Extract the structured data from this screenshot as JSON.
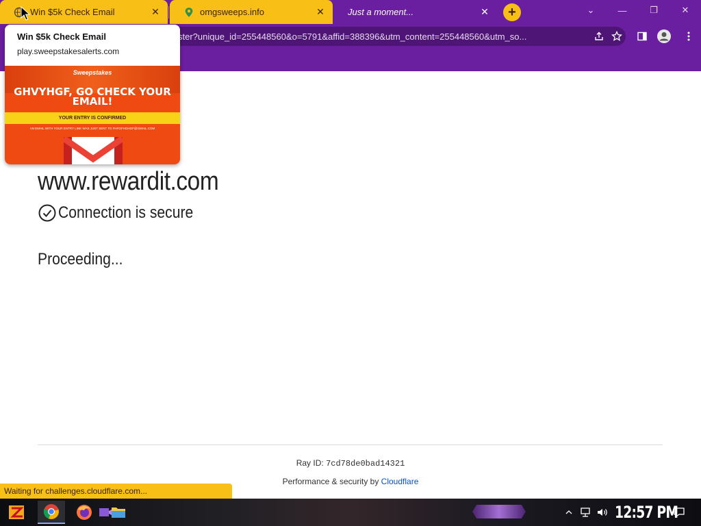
{
  "browser": {
    "tabs": [
      {
        "title": "Win $5k Check Email",
        "close": "✕"
      },
      {
        "title": "omgsweeps.info",
        "close": "✕"
      },
      {
        "title": "Just a moment...",
        "close": "✕"
      }
    ],
    "new_tab": "+",
    "window_controls": {
      "minimize": "—",
      "maximize": "❐",
      "close": "✕",
      "tab_search": "⌄"
    },
    "address_bar": {
      "url": "ster?unique_id=255448560&o=5791&affid=388396&utm_content=255448560&utm_so..."
    }
  },
  "hover_card": {
    "title": "Win $5k Check Email",
    "domain": "play.sweepstakesalerts.com",
    "preview": {
      "brand": "Sweepstakes",
      "headline": "GHVYHGF, GO CHECK YOUR EMAIL!",
      "confirmed": "YOUR ENTRY IS CONFIRMED",
      "sent_note": "AN EMAIL WITH YOUR ENTRY LINK WAS JUST SENT TO FHFGFHGHGF@GMAIL.COM"
    }
  },
  "page": {
    "host": "www.rewardit.com",
    "secure": "Connection is secure",
    "proceeding": "Proceeding...",
    "ray_label": "Ray ID:",
    "ray_id": "7cd78de0bad14321",
    "perf_label": "Performance & security by",
    "perf_link": "Cloudflare"
  },
  "status_bubble": "Waiting for challenges.cloudflare.com...",
  "taskbar": {
    "clock": "12:57 PM",
    "apps": [
      "start-icon",
      "chrome-icon",
      "firefox-icon",
      "video-icon",
      "file-explorer-icon"
    ]
  },
  "colors": {
    "chrome_purple": "#6a1fa0",
    "tab_gold": "#f8bf16",
    "cloudflare_link": "#0051c3"
  }
}
